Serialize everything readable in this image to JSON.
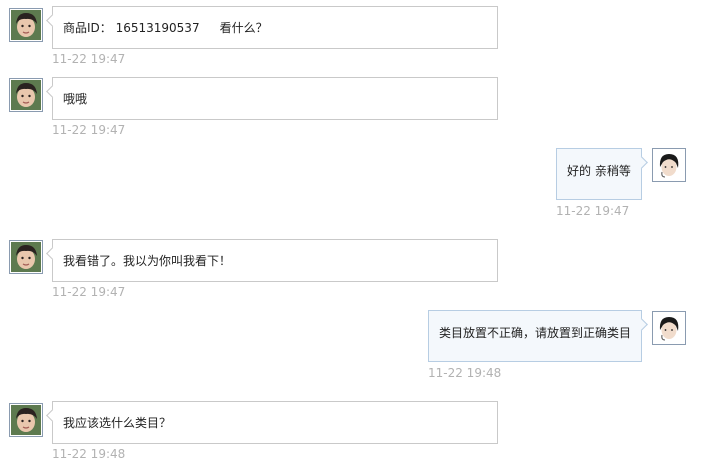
{
  "messages": [
    {
      "side": "left",
      "text_a": "商品ID： 16513190537",
      "text_b": "看什么？",
      "time": "11-22 19:47"
    },
    {
      "side": "left",
      "text": "哦哦",
      "time": "11-22 19:47"
    },
    {
      "side": "right",
      "text": "好的 亲稍等",
      "time": "11-22 19:47"
    },
    {
      "side": "left",
      "text": "我看错了。我以为你叫我看下！",
      "time": "11-22 19:47"
    },
    {
      "side": "right",
      "text": "类目放置不正确，请放置到正确类目",
      "time": "11-22 19:48"
    },
    {
      "side": "left",
      "text": "我应该选什么类目？",
      "time": "11-22 19:48"
    }
  ]
}
